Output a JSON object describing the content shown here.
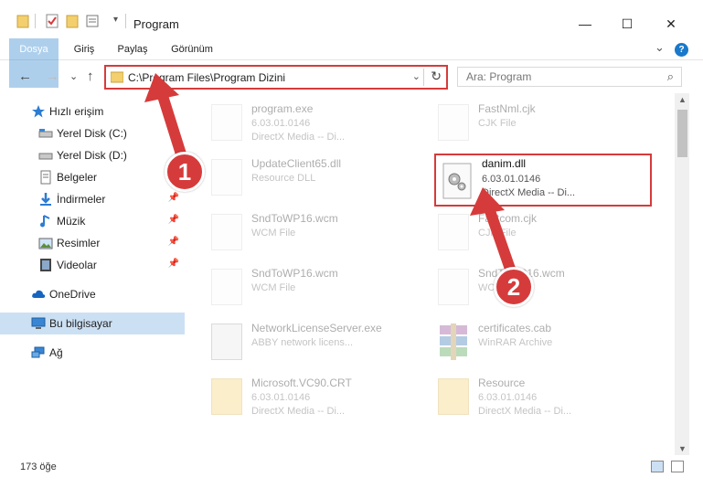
{
  "window": {
    "title": "Program",
    "minimize_glyph": "—",
    "maximize_glyph": "☐",
    "close_glyph": "✕"
  },
  "ribbon": {
    "tabs": [
      "Dosya",
      "Giriş",
      "Paylaş",
      "Görünüm"
    ],
    "expand_glyph": "⌄",
    "help_glyph": "?"
  },
  "navigation": {
    "back_glyph": "←",
    "forward_glyph": "→",
    "history_glyph": "⌄",
    "up_glyph": "↑",
    "address_path": "C:\\Program Files\\Program Dizini",
    "address_dropdown_glyph": "⌄",
    "refresh_glyph": "↻",
    "search_placeholder": "Ara: Program",
    "search_glyph": "⌕"
  },
  "sidebar": {
    "items": [
      {
        "label": "Hızlı erişim",
        "icon": "star-icon"
      },
      {
        "label": "Yerel Disk (C:)",
        "icon": "drive-icon"
      },
      {
        "label": "Yerel Disk (D:)",
        "icon": "drive-icon"
      },
      {
        "label": "Belgeler",
        "icon": "documents-icon"
      },
      {
        "label": "İndirmeler",
        "icon": "downloads-icon"
      },
      {
        "label": "Müzik",
        "icon": "music-icon"
      },
      {
        "label": "Resimler",
        "icon": "pictures-icon"
      },
      {
        "label": "Videolar",
        "icon": "videos-icon"
      },
      {
        "label": "OneDrive",
        "icon": "cloud-icon"
      },
      {
        "label": "Bu bilgisayar",
        "icon": "computer-icon"
      },
      {
        "label": "Ağ",
        "icon": "network-icon"
      }
    ],
    "pin_glyph": "📌"
  },
  "files": [
    {
      "name": "program.exe",
      "line2": "6.03.01.0146",
      "line3": "DirectX Media -- Di..."
    },
    {
      "name": "FastNml.cjk",
      "line2": "CJK File",
      "line3": ""
    },
    {
      "name": "UpdateClient65.dll",
      "line2": "Resource DLL",
      "line3": ""
    },
    {
      "name": "danim.dll",
      "line2": "6.03.01.0146",
      "line3": "DirectX Media -- Di..."
    },
    {
      "name": "SndToWP16.wcm",
      "line2": "WCM File",
      "line3": ""
    },
    {
      "name": "Fastcom.cjk",
      "line2": "CJK File",
      "line3": ""
    },
    {
      "name": "SndToWP16.wcm",
      "line2": "WCM File",
      "line3": ""
    },
    {
      "name": "SndToWP16.wcm",
      "line2": "WCM File",
      "line3": ""
    },
    {
      "name": "NetworkLicenseServer.exe",
      "line2": "ABBY network licens...",
      "line3": ""
    },
    {
      "name": "certificates.cab",
      "line2": "WinRAR Archive",
      "line3": ""
    },
    {
      "name": "Microsoft.VC90.CRT",
      "line2": "6.03.01.0146",
      "line3": "DirectX Media -- Di..."
    },
    {
      "name": "Resource",
      "line2": "6.03.01.0146",
      "line3": "DirectX Media -- Di..."
    }
  ],
  "scrollbar": {
    "up_glyph": "▲",
    "down_glyph": "▼"
  },
  "status": {
    "item_count": "173 öğe"
  },
  "annotations": {
    "badge_1": "1",
    "badge_2": "2"
  },
  "colors": {
    "accent": "#1979ca",
    "highlight": "#d63b3b",
    "selection": "#cce0f4"
  }
}
